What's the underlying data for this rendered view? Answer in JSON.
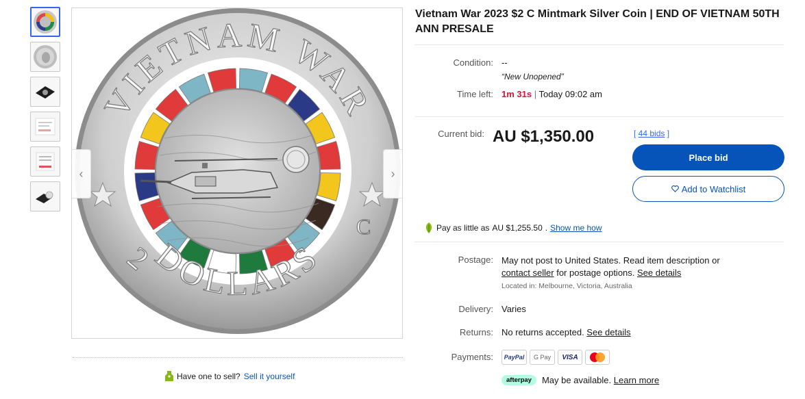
{
  "title": "Vietnam War 2023 $2 C Mintmark Silver Coin | END OF VIETNAM 50TH ANN PRESALE",
  "condition": {
    "label": "Condition:",
    "value": "--",
    "note": "“New Unopened”"
  },
  "time_left": {
    "label": "Time left:",
    "countdown": "1m 31s",
    "separator": " | ",
    "ends": "Today 09:02 am"
  },
  "bid": {
    "label": "Current bid:",
    "price": "AU $1,350.00",
    "bids_open": "[ ",
    "bids_link": "44 bids",
    "bids_close": " ]",
    "place_bid": "Place bid",
    "watchlist": "Add to Watchlist"
  },
  "pay_as_little": {
    "prefix": "Pay as little as ",
    "amount": "AU $1,255.50",
    "dot": ".",
    "link": "Show me how"
  },
  "postage": {
    "label": "Postage:",
    "line1": "May not post to United States. Read item description or",
    "contact_link": "contact seller",
    "line2_mid": " for postage options. ",
    "details_link": "See details",
    "located": "Located in: Melbourne, Victoria, Australia"
  },
  "delivery": {
    "label": "Delivery:",
    "value": "Varies"
  },
  "returns": {
    "label": "Returns:",
    "value": "No returns accepted. ",
    "link": "See details"
  },
  "payments": {
    "label": "Payments:",
    "paypal": "PayPal",
    "gpay": "G Pay",
    "visa": "VISA"
  },
  "afterpay": {
    "pill": "afterpay",
    "text": "May be available. ",
    "link": "Learn more"
  },
  "sell": {
    "question": "Have one to sell?",
    "link": "Sell it yourself"
  },
  "coin": {
    "top_text": "VIETNAM WAR",
    "bottom_text": "DOLLARS",
    "denomination": "2",
    "mintmark": "C"
  },
  "colors": {
    "accent": "#0654ba",
    "timer": "#e0103a",
    "afterpay": "#b2fce4"
  },
  "icons": [
    "chevron-left-icon",
    "chevron-right-icon",
    "heart-icon",
    "tag-icon",
    "leaf-icon",
    "mastercard-icon"
  ]
}
